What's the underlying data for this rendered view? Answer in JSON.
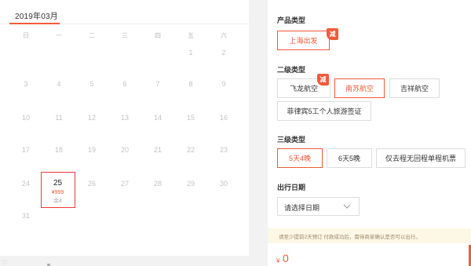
{
  "calendar": {
    "month": "2019年03月",
    "weekdays": [
      "日",
      "一",
      "二",
      "三",
      "四",
      "五",
      "六"
    ],
    "days": {
      "d1": "1",
      "d2": "2",
      "d3": "3",
      "d4": "4",
      "d5": "5",
      "d6": "6",
      "d7": "7",
      "d8": "8",
      "d9": "9",
      "d10": "10",
      "d11": "11",
      "d12": "12",
      "d13": "13",
      "d14": "14",
      "d15": "15",
      "d16": "16",
      "d17": "17",
      "d18": "18",
      "d19": "19",
      "d20": "20",
      "d21": "21",
      "d22": "22",
      "d23": "23",
      "d24": "24",
      "d26": "26",
      "d27": "27",
      "d28": "28",
      "d29": "29",
      "d30": "30",
      "d31": "31"
    },
    "selected_day": {
      "day": "25",
      "price": "¥999",
      "stock": "余4"
    },
    "bottom_icon": "♡"
  },
  "options": {
    "product_type": {
      "title": "产品类型",
      "items": [
        {
          "label": "上海出发",
          "badge": "减"
        }
      ]
    },
    "level2": {
      "title": "二级类型",
      "items": [
        {
          "label": "飞龙航空",
          "badge": "减"
        },
        {
          "label": "南苏航空"
        },
        {
          "label": "吉祥航空"
        },
        {
          "label": "菲律宾5工个人旅游签证"
        }
      ]
    },
    "level3": {
      "title": "三级类型",
      "items": [
        {
          "label": "5天4晚"
        },
        {
          "label": "6天5晚"
        },
        {
          "label": "仅去程无回程单程机票"
        }
      ]
    },
    "travel_date": {
      "title": "出行日期",
      "placeholder": "请选择日期"
    },
    "notice": "请至少提前2天预订 付款成功后，需待商家确认是否可以出行。",
    "price": {
      "currency": "¥",
      "value": "0"
    }
  },
  "colors": {
    "accent": "#f25a3a",
    "selected_border": "#ee3a3a",
    "notice_bg": "#fdf7e6"
  },
  "icons": [
    "chevron-down-icon",
    "heart-icon"
  ]
}
